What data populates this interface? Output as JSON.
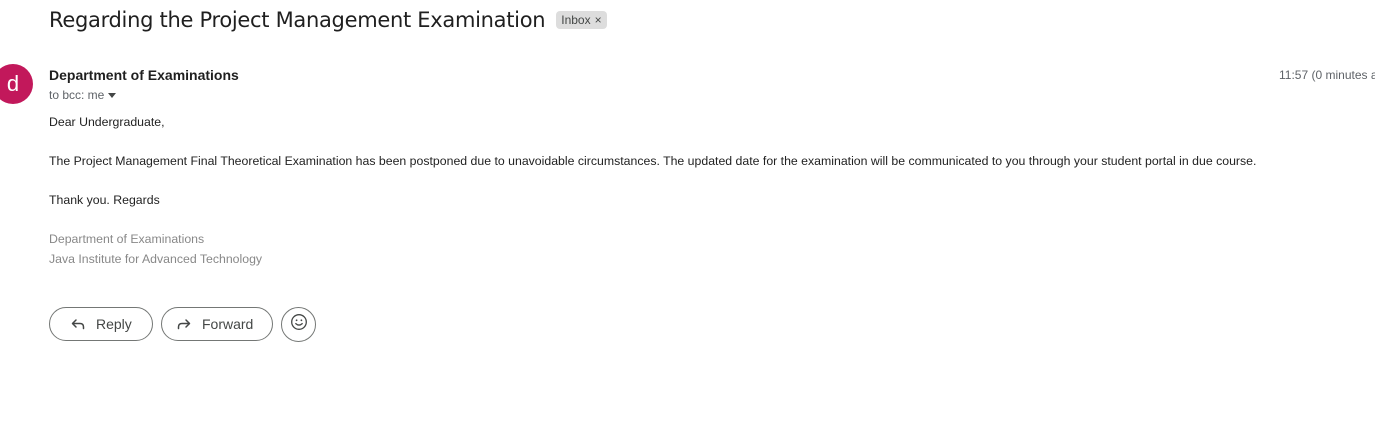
{
  "subject": "Regarding the Project Management Examination",
  "label": {
    "text": "Inbox",
    "remove_glyph": "×"
  },
  "avatar": {
    "letter": "d",
    "color": "#c2185b"
  },
  "sender": "Department of Examinations",
  "recipients": "to bcc: me",
  "timestamp": "11:57 (0 minutes a",
  "message": {
    "greeting": "Dear Undergraduate,",
    "paragraph": "The Project Management Final Theoretical Examination has been postponed due to unavoidable circumstances. The updated date for the examination will be communicated to you through your student portal in due course.",
    "closing": "Thank you. Regards",
    "signature": [
      "Department of Examinations",
      "Java Institute for Advanced Technology"
    ]
  },
  "actions": {
    "reply": "Reply",
    "forward": "Forward"
  },
  "icons": {
    "reply": "reply-arrow-icon",
    "forward": "forward-arrow-icon",
    "emoji": "smiley-face-icon",
    "recipients_toggle": "caret-down-icon"
  }
}
